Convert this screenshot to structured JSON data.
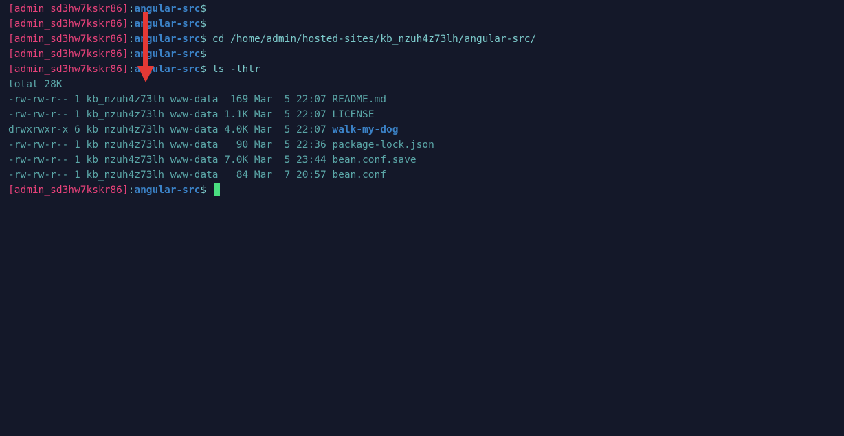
{
  "prompt": {
    "user": "[admin_sd3hw7kskr86]",
    "colon": ":",
    "path": "angular-src",
    "dollar": "$"
  },
  "lines": [
    {
      "type": "prompt",
      "cmd": ""
    },
    {
      "type": "prompt",
      "cmd": ""
    },
    {
      "type": "prompt",
      "cmd": " cd /home/admin/hosted-sites/kb_nzuh4z73lh/angular-src/"
    },
    {
      "type": "prompt",
      "cmd": ""
    },
    {
      "type": "prompt",
      "cmd": " ls -lhtr"
    }
  ],
  "ls_total": "total 28K",
  "ls_rows": [
    {
      "perms": "-rw-rw-r--",
      "links": "1",
      "owner": "kb_nzuh4z73lh",
      "group": "www-data",
      "size": " 169",
      "month": "Mar",
      "day": " 5",
      "time": "22:07",
      "name": "README.md",
      "is_dir": false
    },
    {
      "perms": "-rw-rw-r--",
      "links": "1",
      "owner": "kb_nzuh4z73lh",
      "group": "www-data",
      "size": "1.1K",
      "month": "Mar",
      "day": " 5",
      "time": "22:07",
      "name": "LICENSE",
      "is_dir": false
    },
    {
      "perms": "drwxrwxr-x",
      "links": "6",
      "owner": "kb_nzuh4z73lh",
      "group": "www-data",
      "size": "4.0K",
      "month": "Mar",
      "day": " 5",
      "time": "22:07",
      "name": "walk-my-dog",
      "is_dir": true
    },
    {
      "perms": "-rw-rw-r--",
      "links": "1",
      "owner": "kb_nzuh4z73lh",
      "group": "www-data",
      "size": "  90",
      "month": "Mar",
      "day": " 5",
      "time": "22:36",
      "name": "package-lock.json",
      "is_dir": false
    },
    {
      "perms": "-rw-rw-r--",
      "links": "1",
      "owner": "kb_nzuh4z73lh",
      "group": "www-data",
      "size": "7.0K",
      "month": "Mar",
      "day": " 5",
      "time": "23:44",
      "name": "bean.conf.save",
      "is_dir": false
    },
    {
      "perms": "-rw-rw-r--",
      "links": "1",
      "owner": "kb_nzuh4z73lh",
      "group": "www-data",
      "size": "  84",
      "month": "Mar",
      "day": " 7",
      "time": "20:57",
      "name": "bean.conf",
      "is_dir": false
    }
  ],
  "arrow_color": "#e53935"
}
